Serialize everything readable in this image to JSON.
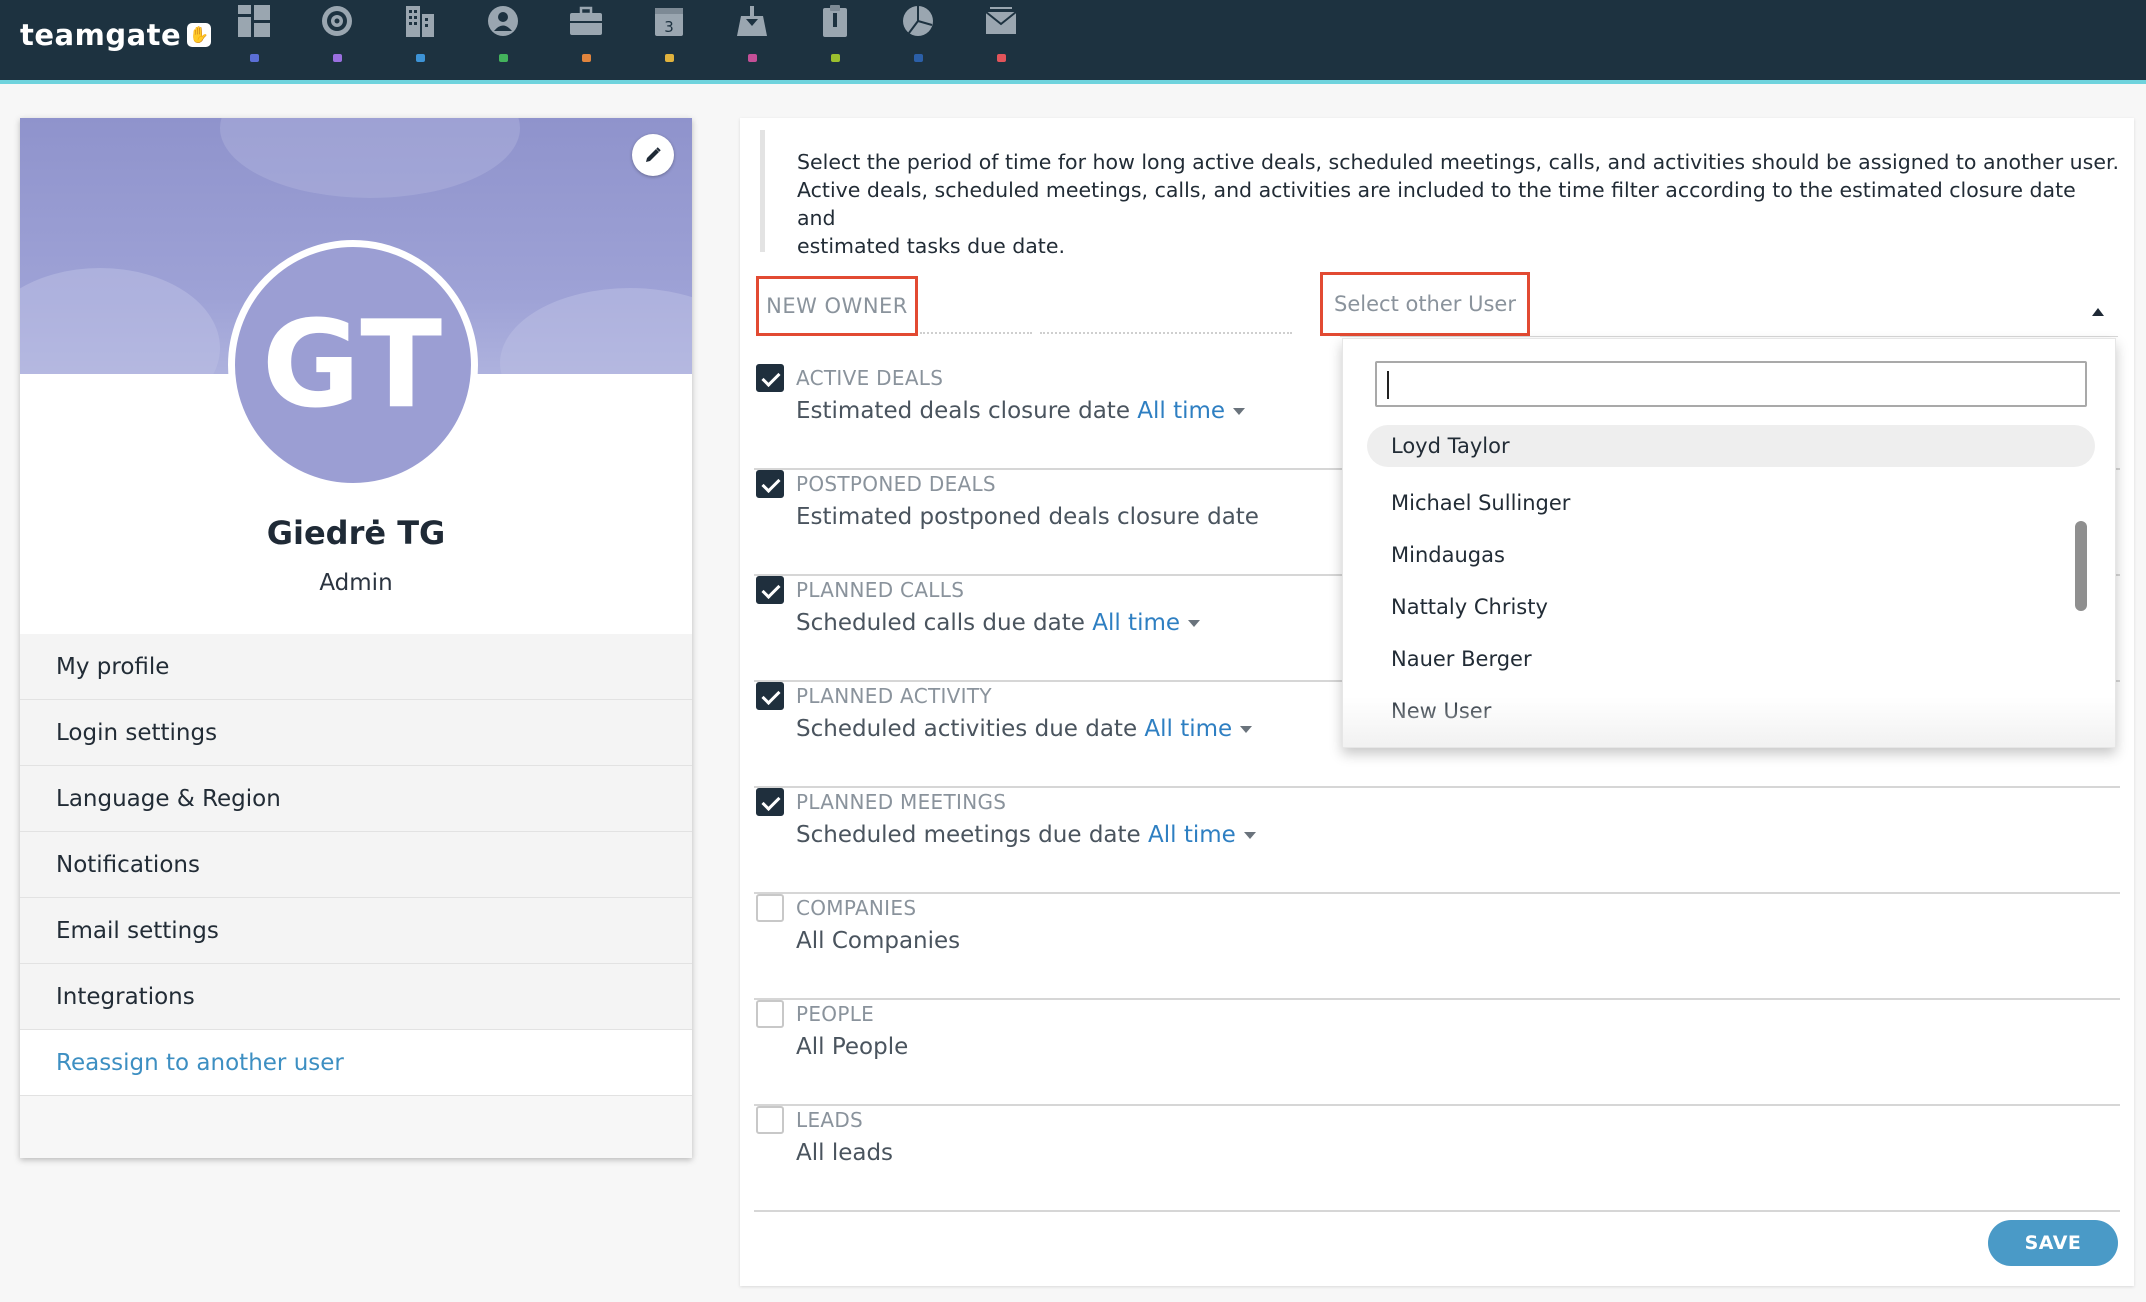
{
  "app": {
    "logo_text": "teamgate"
  },
  "nav": {
    "items": [
      {
        "icon": "dashboard-icon",
        "color": "#5b6fd6"
      },
      {
        "icon": "target-icon",
        "color": "#9a6fe0"
      },
      {
        "icon": "buildings-icon",
        "color": "#3d93d6"
      },
      {
        "icon": "contact-icon",
        "color": "#43b35c"
      },
      {
        "icon": "briefcase-icon",
        "color": "#e0843d"
      },
      {
        "icon": "calendar-icon",
        "color": "#e0b23d"
      },
      {
        "icon": "inbox-download-icon",
        "color": "#c44f97"
      },
      {
        "icon": "clipboard-icon",
        "color": "#9bbf2e"
      },
      {
        "icon": "pie-chart-icon",
        "color": "#2b5fa8"
      },
      {
        "icon": "mail-icon",
        "color": "#e2545a"
      }
    ],
    "calendar_day": "3"
  },
  "profile": {
    "initials": "GT",
    "name": "Giedrė TG",
    "role": "Admin",
    "avatar_color": "#9b9ed3",
    "menu": [
      {
        "label": "My profile"
      },
      {
        "label": "Login settings"
      },
      {
        "label": "Language & Region"
      },
      {
        "label": "Notifications"
      },
      {
        "label": "Email settings"
      },
      {
        "label": "Integrations"
      },
      {
        "label": "Reassign to another user"
      }
    ]
  },
  "main": {
    "info_line1": "Select the period of time for how long active deals, scheduled meetings, calls, and activities should be assigned to another user.",
    "info_line2": "Active deals, scheduled meetings, calls, and activities are included to the time filter according to the estimated closure date and",
    "info_line3": "estimated tasks due date.",
    "new_owner_label": "NEW OWNER",
    "select_user_placeholder": "Select other User",
    "rows": [
      {
        "title": "ACTIVE DEALS",
        "sub": "Estimated deals closure date",
        "link": "All time",
        "checked": true
      },
      {
        "title": "POSTPONED DEALS",
        "sub": "Estimated postponed deals closure date",
        "link": "",
        "checked": true
      },
      {
        "title": "PLANNED CALLS",
        "sub": "Scheduled calls due date",
        "link": "All time",
        "checked": true
      },
      {
        "title": "PLANNED ACTIVITY",
        "sub": "Scheduled activities due date",
        "link": "All time",
        "checked": true
      },
      {
        "title": "PLANNED MEETINGS",
        "sub": "Scheduled meetings due date",
        "link": "All time",
        "checked": true
      },
      {
        "title": "COMPANIES",
        "sub": "All Companies",
        "link": "",
        "checked": false
      },
      {
        "title": "PEOPLE",
        "sub": "All People",
        "link": "",
        "checked": false
      },
      {
        "title": "LEADS",
        "sub": "All leads",
        "link": "",
        "checked": false
      }
    ],
    "save_label": "SAVE"
  },
  "dropdown": {
    "search_value": "",
    "options": [
      {
        "label": "Loyd Taylor",
        "highlighted": true
      },
      {
        "label": "Michael Sullinger"
      },
      {
        "label": "Mindaugas"
      },
      {
        "label": "Nattaly Christy"
      },
      {
        "label": "Nauer Berger"
      },
      {
        "label": "New User"
      }
    ]
  }
}
